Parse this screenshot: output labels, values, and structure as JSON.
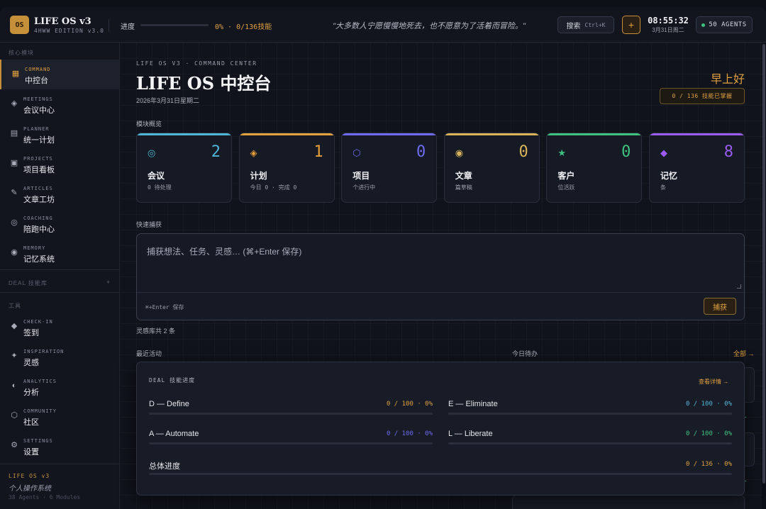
{
  "topbar": {
    "logo": "OS",
    "brand_title": "LIFE OS v3",
    "brand_subtitle": "4HWW EDITION v3.0",
    "progress_label": "进度",
    "progress_fraction": 0,
    "progress_text": "0% · 0/136技能",
    "quote": "\"大多数人宁愿慢慢地死去，也不愿意为了活着而冒险。\"",
    "search_label": "搜索",
    "search_shortcut": "Ctrl+K",
    "add_label": "+",
    "time": "08:55:32",
    "date": "3月31日周二",
    "agents_label": "50 AGENTS"
  },
  "sidebar": {
    "section_core": "核心模块",
    "items": [
      {
        "en": "COMMAND",
        "cn": "中控台",
        "icon": "grid-icon",
        "glyph": "▦"
      },
      {
        "en": "MEETINGS",
        "cn": "会议中心",
        "icon": "diamond-dot-icon",
        "glyph": "◈"
      },
      {
        "en": "PLANNER",
        "cn": "统一计划",
        "icon": "list-icon",
        "glyph": "▤"
      },
      {
        "en": "PROJECTS",
        "cn": "项目看板",
        "icon": "board-icon",
        "glyph": "▣"
      },
      {
        "en": "ARTICLES",
        "cn": "文章工坊",
        "icon": "pen-icon",
        "glyph": "✎"
      },
      {
        "en": "COACHING",
        "cn": "陪跑中心",
        "icon": "target-icon",
        "glyph": "◎"
      },
      {
        "en": "MEMORY",
        "cn": "记忆系统",
        "icon": "record-icon",
        "glyph": "◉"
      }
    ],
    "section_deal": "DEAL 技能库",
    "deal_toggle": "+",
    "section_tools": "工具",
    "tools": [
      {
        "en": "CHECK-IN",
        "cn": "签到",
        "icon": "diamond-icon",
        "glyph": "◆"
      },
      {
        "en": "INSPIRATION",
        "cn": "灵感",
        "icon": "sparkle-icon",
        "glyph": "✦"
      },
      {
        "en": "ANALYTICS",
        "cn": "分析",
        "icon": "half-circle-icon",
        "glyph": "◐"
      },
      {
        "en": "COMMUNITY",
        "cn": "社区",
        "icon": "hexagon-icon",
        "glyph": "⬡"
      },
      {
        "en": "SETTINGS",
        "cn": "设置",
        "icon": "gear-icon",
        "glyph": "⚙"
      }
    ],
    "footer_title": "LIFE OS v3",
    "footer_subtitle": "个人操作系统",
    "footer_meta": "38 Agents · 6 Modules"
  },
  "header": {
    "eyebrow": "LIFE OS V3 · COMMAND CENTER",
    "title": "LIFE OS 中控台",
    "date": "2026年3月31日星期二",
    "greeting": "早上好",
    "skill_badge": "0 / 136 技能已掌握"
  },
  "overview": {
    "label": "模块概览",
    "cards": [
      {
        "title": "会议",
        "value": "2",
        "sub": "0 待处理",
        "icon": "target-icon",
        "glyph": "◎",
        "color": "#4fb6d8"
      },
      {
        "title": "计划",
        "value": "1",
        "sub": "今日 0 · 完成 0",
        "icon": "diamond-dot-icon",
        "glyph": "◈",
        "color": "#e6a03c"
      },
      {
        "title": "项目",
        "value": "0",
        "sub": "个进行中",
        "icon": "hexagon-icon",
        "glyph": "⬡",
        "color": "#6f6bf0"
      },
      {
        "title": "文章",
        "value": "0",
        "sub": "篇草稿",
        "icon": "record-icon",
        "glyph": "◉",
        "color": "#d9b45a"
      },
      {
        "title": "客户",
        "value": "0",
        "sub": "位活跃",
        "icon": "star-icon",
        "glyph": "★",
        "color": "#3fc27f"
      },
      {
        "title": "记忆",
        "value": "8",
        "sub": "条",
        "icon": "diamond-icon",
        "glyph": "◆",
        "color": "#9a5cf0"
      }
    ]
  },
  "capture": {
    "label": "快速捕获",
    "placeholder": "捕获想法、任务、灵感… (⌘+Enter 保存)",
    "hint": "⌘+Enter 保存",
    "button": "捕获",
    "inspiration_count": "灵感库共 2 条"
  },
  "activity": {
    "recent_label": "最近活动",
    "todo_label": "今日待办",
    "all_link": "全部 →",
    "arrow1": "→",
    "arrow2": "→"
  },
  "deal": {
    "title": "DEAL 技能进度",
    "details_link": "查看详情 →",
    "rows": [
      {
        "name": "D — Define",
        "value": "0 / 100 · 0%",
        "fraction": 0,
        "color": "#e0a040"
      },
      {
        "name": "E — Eliminate",
        "value": "0 / 100 · 0%",
        "fraction": 0,
        "color": "#4fb6d8"
      },
      {
        "name": "A — Automate",
        "value": "0 / 100 · 0%",
        "fraction": 0,
        "color": "#6f6bf0"
      },
      {
        "name": "L — Liberate",
        "value": "0 / 100 · 0%",
        "fraction": 0,
        "color": "#3fc27f"
      }
    ],
    "total": {
      "name": "总体进度",
      "value": "0 / 136 · 0%",
      "fraction": 0,
      "color": "#e0a040"
    }
  }
}
